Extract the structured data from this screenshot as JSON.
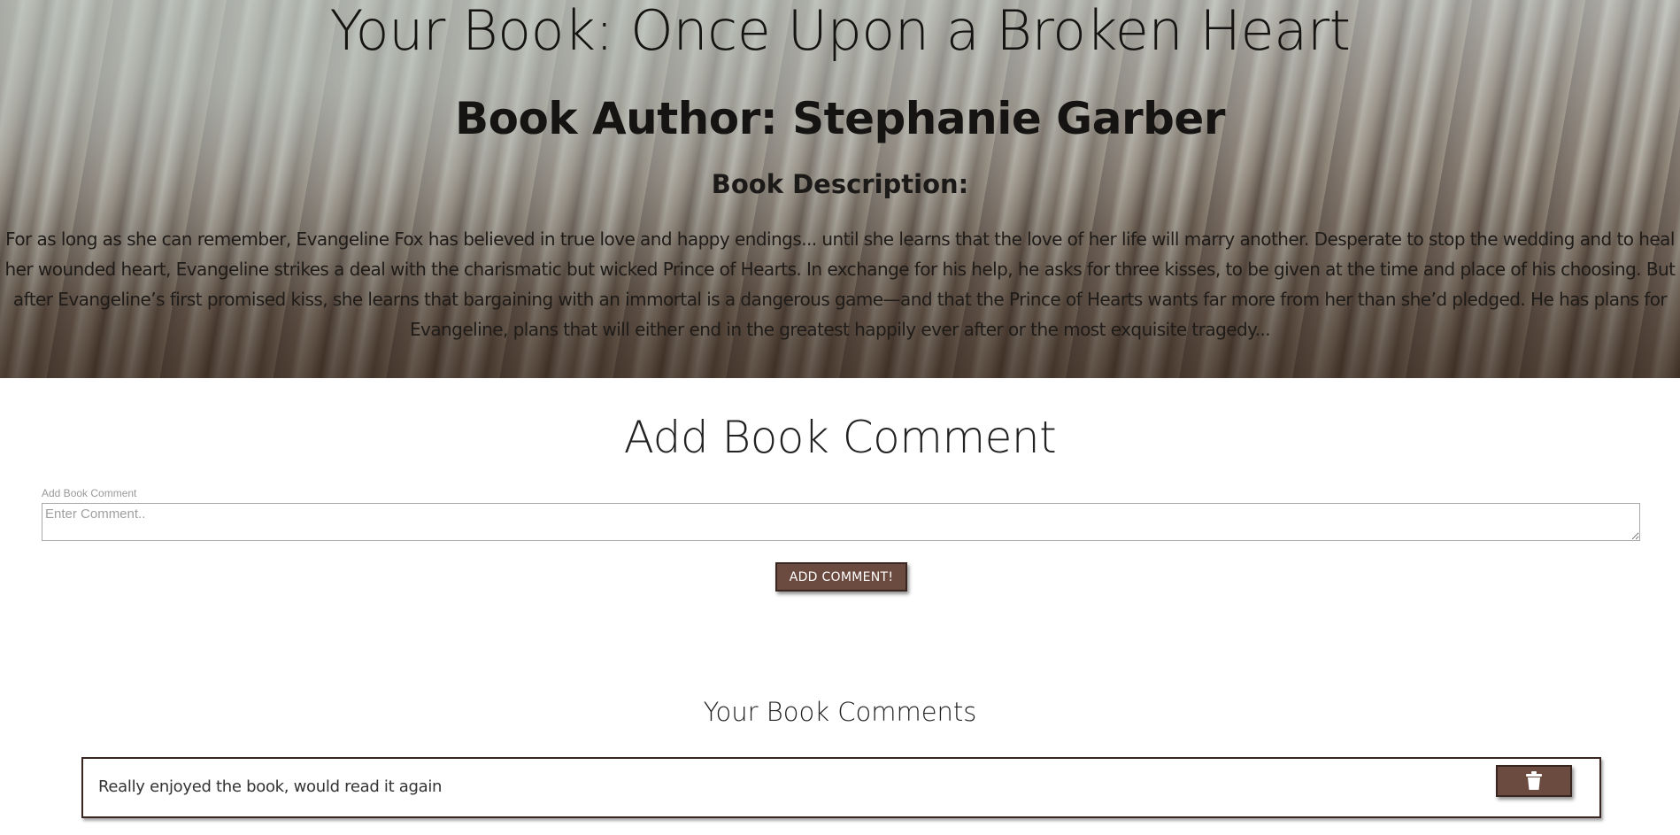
{
  "hero": {
    "title": "Your Book: Once Upon a Broken Heart",
    "author": "Book Author: Stephanie Garber",
    "description_heading": "Book Description:",
    "description": "For as long as she can remember, Evangeline Fox has believed in true love and happy endings... until she learns that the love of her life will marry another. Desperate to stop the wedding and to heal her wounded heart, Evangeline strikes a deal with the charismatic but wicked Prince of Hearts. In exchange for his help, he asks for three kisses, to be given at the time and place of his choosing. But after Evangeline’s first promised kiss, she learns that bargaining with an immortal is a dangerous game—and that the Prince of Hearts wants far more from her than she’d pledged. He has plans for Evangeline, plans that will either end in the greatest happily ever after or the most exquisite tragedy..."
  },
  "add_comment": {
    "heading": "Add Book Comment",
    "field_label": "Add Book Comment",
    "placeholder": "Enter Comment..",
    "value": "",
    "button_label": "ADD COMMENT!"
  },
  "comments": {
    "heading": "Your Book Comments",
    "items": [
      {
        "text": "Really enjoyed the book, would read it again",
        "delete_icon": "trash-icon"
      }
    ]
  },
  "colors": {
    "button_bg": "#6b4a3f",
    "button_border": "#3a2620"
  }
}
